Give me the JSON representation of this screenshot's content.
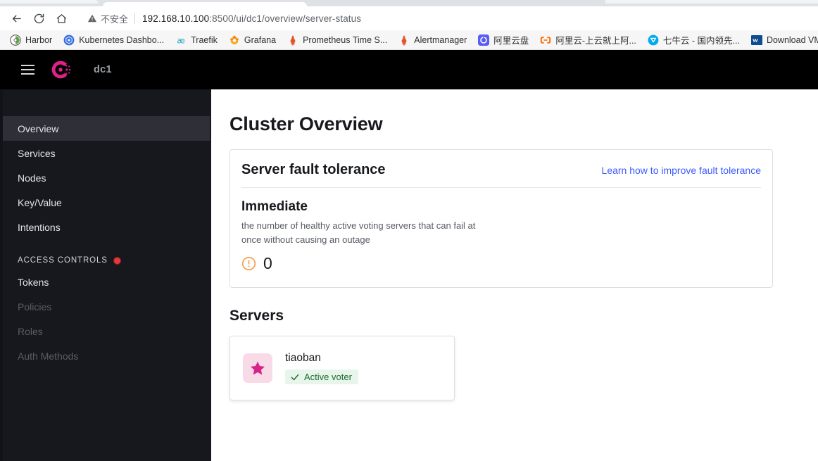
{
  "browser": {
    "nav": {
      "back_label": "Back",
      "reload_label": "Reload",
      "home_label": "Home"
    },
    "omnibox": {
      "security_label": "不安全",
      "url_host": "192.168.10.100",
      "url_path": ":8500/ui/dc1/overview/server-status",
      "full_url": "192.168.10.100:8500/ui/dc1/overview/server-status"
    },
    "bookmarks": [
      {
        "label": "Harbor",
        "icon": "harbor-icon",
        "color": "#3d8c40"
      },
      {
        "label": "Kubernetes Dashbo...",
        "icon": "kubernetes-icon",
        "color": "#326ce5"
      },
      {
        "label": "Traefik",
        "icon": "traefik-icon",
        "color": "#24a1c1"
      },
      {
        "label": "Grafana",
        "icon": "grafana-icon",
        "color": "#f46800"
      },
      {
        "label": "Prometheus Time S...",
        "icon": "prometheus-icon",
        "color": "#e6522c"
      },
      {
        "label": "Alertmanager",
        "icon": "alertmanager-icon",
        "color": "#e6522c"
      },
      {
        "label": "阿里云盘",
        "icon": "aliyun-drive-icon",
        "color": "#5b5bf5"
      },
      {
        "label": "阿里云-上云就上阿...",
        "icon": "aliyun-icon",
        "color": "#ff6a00"
      },
      {
        "label": "七牛云 - 国内领先...",
        "icon": "qiniu-icon",
        "color": "#00aaee"
      },
      {
        "label": "Download VMwa",
        "icon": "vmware-icon",
        "color": "#0f4b8f"
      }
    ]
  },
  "app": {
    "header": {
      "menu_label": "menu",
      "logo_label": "consul-logo",
      "datacenter": "dc1"
    },
    "sidebar": {
      "items": [
        {
          "label": "Overview",
          "name": "sidebar-item-overview",
          "state": "active"
        },
        {
          "label": "Services",
          "name": "sidebar-item-services",
          "state": "normal"
        },
        {
          "label": "Nodes",
          "name": "sidebar-item-nodes",
          "state": "normal"
        },
        {
          "label": "Key/Value",
          "name": "sidebar-item-key-value",
          "state": "normal"
        },
        {
          "label": "Intentions",
          "name": "sidebar-item-intentions",
          "state": "normal"
        }
      ],
      "section_label": "ACCESS CONTROLS",
      "acl_items": [
        {
          "label": "Tokens",
          "name": "sidebar-item-tokens",
          "state": "normal"
        },
        {
          "label": "Policies",
          "name": "sidebar-item-policies",
          "state": "disabled"
        },
        {
          "label": "Roles",
          "name": "sidebar-item-roles",
          "state": "disabled"
        },
        {
          "label": "Auth Methods",
          "name": "sidebar-item-auth-methods",
          "state": "disabled"
        }
      ]
    },
    "main": {
      "page_title": "Cluster Overview",
      "fault_tolerance": {
        "title": "Server fault tolerance",
        "link": "Learn how to improve fault tolerance",
        "metric_name": "Immediate",
        "metric_description": "the number of healthy active voting servers that can fail at once without causing an outage",
        "metric_value": "0",
        "metric_status_icon": "warning-icon",
        "metric_status_color": "#f59b4b"
      },
      "servers": {
        "section_title": "Servers",
        "list": [
          {
            "name": "tiaoban",
            "avatar_icon": "star-icon",
            "avatar_color": "#d6248a",
            "status_label": "Active voter",
            "status_icon": "check-icon",
            "status_color": "#1d6c2e"
          }
        ]
      }
    }
  }
}
